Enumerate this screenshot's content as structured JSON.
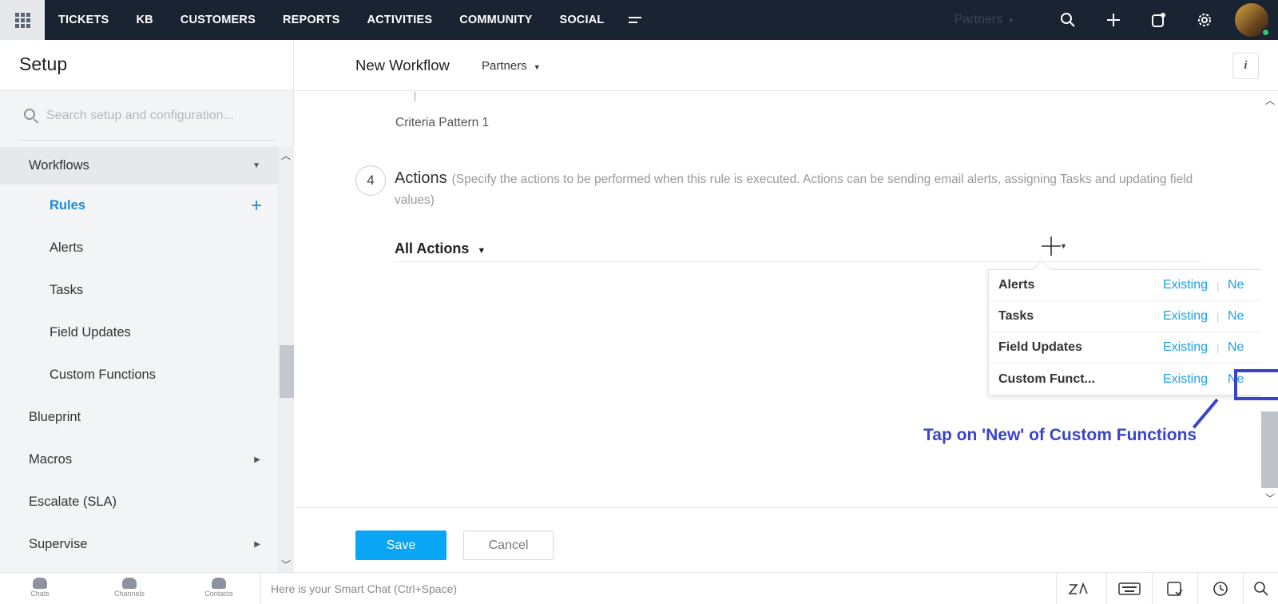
{
  "topbar": {
    "nav": [
      "TICKETS",
      "KB",
      "CUSTOMERS",
      "REPORTS",
      "ACTIVITIES",
      "COMMUNITY",
      "SOCIAL"
    ],
    "more_icon": "menu-lines-icon",
    "department": "Partners",
    "icons": [
      "search-icon",
      "plus-icon",
      "compose-icon",
      "gear-icon"
    ]
  },
  "sidebar": {
    "title": "Setup",
    "search_placeholder": "Search setup and configuration...",
    "items": [
      {
        "label": "Workflows"
      },
      {
        "label": "Rules"
      },
      {
        "label": "Alerts"
      },
      {
        "label": "Tasks"
      },
      {
        "label": "Field Updates"
      },
      {
        "label": "Custom Functions"
      },
      {
        "label": "Blueprint"
      },
      {
        "label": "Macros"
      },
      {
        "label": "Escalate (SLA)"
      },
      {
        "label": "Supervise"
      }
    ]
  },
  "header": {
    "title": "New Workflow",
    "department": "Partners",
    "info_label": "i"
  },
  "content": {
    "criteria": "Criteria Pattern 1",
    "step_number": "4",
    "actions_heading": "Actions",
    "actions_desc": "(Specify the actions to be performed when this rule is executed. Actions can be sending email alerts, assigning Tasks and updating field values)",
    "all_actions": "All Actions",
    "dropdown": [
      {
        "label": "Alerts",
        "existing": "Existing",
        "new": "Ne"
      },
      {
        "label": "Tasks",
        "existing": "Existing",
        "new": "Ne"
      },
      {
        "label": "Field Updates",
        "existing": "Existing",
        "new": "Ne"
      },
      {
        "label": "Custom Funct...",
        "existing": "Existing",
        "new": "Ne"
      }
    ],
    "annotation": "Tap on 'New' of Custom Functions"
  },
  "footer": {
    "save": "Save",
    "cancel": "Cancel"
  },
  "bottombar": {
    "tabs": [
      "Chats",
      "Channels",
      "Contacts"
    ],
    "smart_chat_placeholder": "Here is your Smart Chat (Ctrl+Space)"
  },
  "colors": {
    "topbar": "#1a2332",
    "accent": "#0ba5f5",
    "link": "#1aa3e8",
    "annotation": "#3b44c9"
  }
}
